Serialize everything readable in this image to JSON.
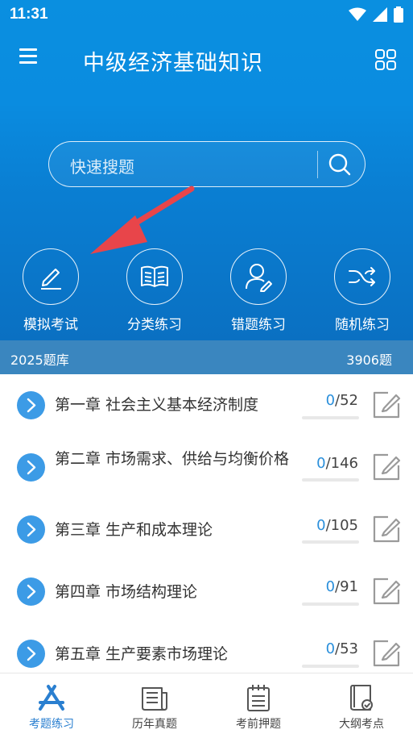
{
  "status_bar": {
    "time": "11:31"
  },
  "app_bar": {
    "title": "中级经济基础知识"
  },
  "search": {
    "placeholder": "快速搜题"
  },
  "features": [
    {
      "label": "模拟考试",
      "icon": "pencil-icon"
    },
    {
      "label": "分类练习",
      "icon": "book-icon"
    },
    {
      "label": "错题练习",
      "icon": "user-edit-icon"
    },
    {
      "label": "随机练习",
      "icon": "shuffle-icon"
    }
  ],
  "question_bank": {
    "name": "2025题库",
    "total": "3906题"
  },
  "chapters": [
    {
      "title": "第一章 社会主义基本经济制度",
      "done": "0",
      "total": "/52",
      "progress": 0
    },
    {
      "title": "第二章 市场需求、供给与均衡价格",
      "done": "0",
      "total": "/146",
      "progress": 0
    },
    {
      "title": "第三章 生产和成本理论",
      "done": "0",
      "total": "/105",
      "progress": 0
    },
    {
      "title": "第四章 市场结构理论",
      "done": "0",
      "total": "/91",
      "progress": 0
    },
    {
      "title": "第五章 生产要素市场理论",
      "done": "0",
      "total": "/53",
      "progress": 0
    }
  ],
  "tabs": [
    {
      "label": "考题练习",
      "icon": "app-store-icon",
      "active": true
    },
    {
      "label": "历年真题",
      "icon": "newspaper-icon",
      "active": false
    },
    {
      "label": "考前押题",
      "icon": "notepad-icon",
      "active": false
    },
    {
      "label": "大纲考点",
      "icon": "book-check-icon",
      "active": false
    }
  ],
  "colors": {
    "accent": "#0a8ce0",
    "bank_bar": "#3a86bf",
    "chevron": "#3c9be6",
    "active_tab": "#2a7fd0",
    "arrow": "#e8454a"
  }
}
